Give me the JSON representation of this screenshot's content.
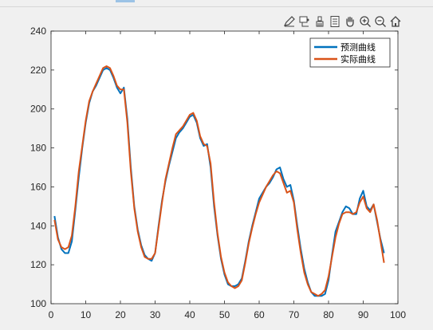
{
  "toolbar": {
    "icons": [
      "edit-plot-icon",
      "data-tips-icon",
      "brush-icon",
      "legend-icon",
      "pan-hand-icon",
      "zoom-in-icon",
      "zoom-out-icon",
      "home-icon"
    ]
  },
  "colors": {
    "predicted": "#0072BD",
    "actual": "#D95319",
    "figure_bg": "#f0f0f0",
    "axes_bg": "#ffffff"
  },
  "chart_data": {
    "type": "line",
    "title": "",
    "xlabel": "",
    "ylabel": "",
    "xlim": [
      0,
      100
    ],
    "ylim": [
      100,
      240
    ],
    "xticks": [
      0,
      10,
      20,
      30,
      40,
      50,
      60,
      70,
      80,
      90,
      100
    ],
    "yticks": [
      100,
      120,
      140,
      160,
      180,
      200,
      220,
      240
    ],
    "grid": false,
    "legend_position": "top-right",
    "x": [
      1,
      2,
      3,
      4,
      5,
      6,
      7,
      8,
      9,
      10,
      11,
      12,
      13,
      14,
      15,
      16,
      17,
      18,
      19,
      20,
      21,
      22,
      23,
      24,
      25,
      26,
      27,
      28,
      29,
      30,
      31,
      32,
      33,
      34,
      35,
      36,
      37,
      38,
      39,
      40,
      41,
      42,
      43,
      44,
      45,
      46,
      47,
      48,
      49,
      50,
      51,
      52,
      53,
      54,
      55,
      56,
      57,
      58,
      59,
      60,
      61,
      62,
      63,
      64,
      65,
      66,
      67,
      68,
      69,
      70,
      71,
      72,
      73,
      74,
      75,
      76,
      77,
      78,
      79,
      80,
      81,
      82,
      83,
      84,
      85,
      86,
      87,
      88,
      89,
      90,
      91,
      92,
      93,
      94,
      95,
      96
    ],
    "series": [
      {
        "name": "预测曲线",
        "color": "#0072BD",
        "values": [
          145,
          134,
          128,
          126,
          126,
          132,
          148,
          165,
          180,
          193,
          203,
          209,
          212,
          216,
          220,
          221,
          220,
          216,
          211,
          208,
          211,
          195,
          170,
          150,
          138,
          130,
          125,
          123,
          122,
          126,
          140,
          153,
          163,
          171,
          178,
          185,
          188,
          190,
          193,
          196,
          197,
          193,
          185,
          181,
          182,
          170,
          150,
          135,
          123,
          115,
          110,
          109,
          109,
          110,
          113,
          122,
          132,
          140,
          147,
          154,
          157,
          160,
          162,
          165,
          169,
          170,
          164,
          160,
          161,
          153,
          140,
          128,
          118,
          111,
          106,
          104,
          104,
          104,
          105,
          112,
          125,
          137,
          142,
          147,
          150,
          149,
          146,
          146,
          154,
          158,
          150,
          148,
          151,
          142,
          133,
          126
        ],
        "legend_label": "预测曲线"
      },
      {
        "name": "实际曲线",
        "color": "#D95319",
        "values": [
          143,
          133,
          129,
          128,
          129,
          135,
          150,
          168,
          181,
          194,
          204,
          209,
          213,
          217,
          221,
          222,
          221,
          217,
          212,
          210,
          210,
          193,
          168,
          149,
          137,
          129,
          124,
          123,
          123,
          126,
          139,
          152,
          164,
          172,
          180,
          187,
          189,
          191,
          194,
          197,
          198,
          194,
          186,
          182,
          181,
          172,
          152,
          136,
          124,
          116,
          111,
          109,
          108,
          109,
          112,
          121,
          131,
          139,
          146,
          152,
          156,
          160,
          163,
          166,
          168,
          167,
          162,
          157,
          158,
          152,
          138,
          126,
          116,
          110,
          106,
          105,
          104,
          105,
          107,
          114,
          124,
          134,
          141,
          146,
          147,
          147,
          146,
          147,
          152,
          155,
          149,
          147,
          151,
          143,
          132,
          121
        ],
        "legend_label": "实际曲线"
      }
    ]
  }
}
